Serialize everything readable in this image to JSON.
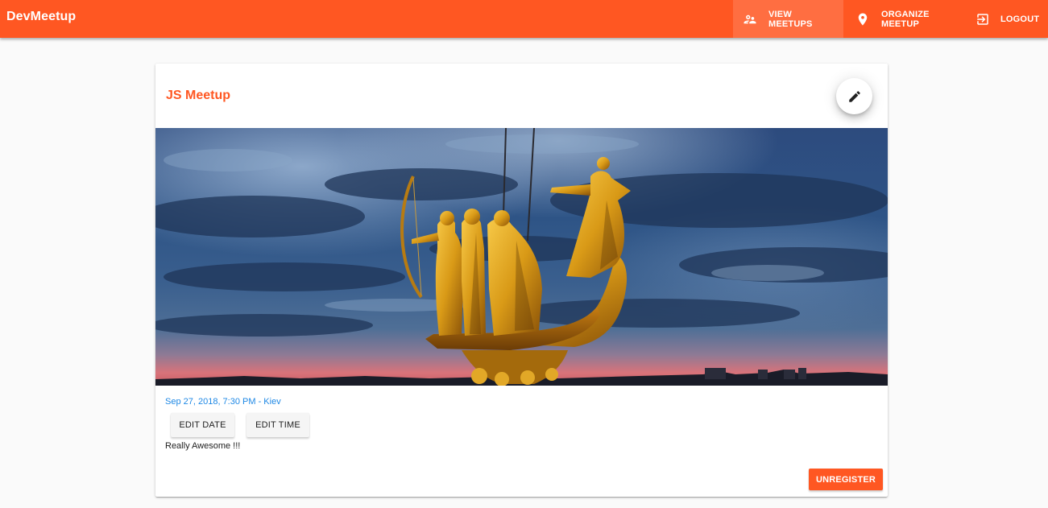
{
  "app": {
    "title": "DevMeetup"
  },
  "nav": {
    "items": [
      {
        "label": "VIEW MEETUPS",
        "icon": "people-icon",
        "active": true
      },
      {
        "label": "ORGANIZE MEETUP",
        "icon": "location-pin-icon",
        "active": false
      },
      {
        "label": "LOGOUT",
        "icon": "exit-to-app-icon",
        "active": false
      }
    ]
  },
  "meetup": {
    "title": "JS Meetup",
    "date_location": "Sep 27, 2018, 7:30 PM - Kiev",
    "edit_date_label": "EDIT DATE",
    "edit_time_label": "EDIT TIME",
    "description": "Really Awesome !!!",
    "unregister_label": "UNREGISTER",
    "image_subject": "monument-boat-statue-at-dusk-photo"
  },
  "colors": {
    "primary": "#ff5722",
    "accent_blue": "#1e88e5",
    "background": "#fafafa"
  }
}
